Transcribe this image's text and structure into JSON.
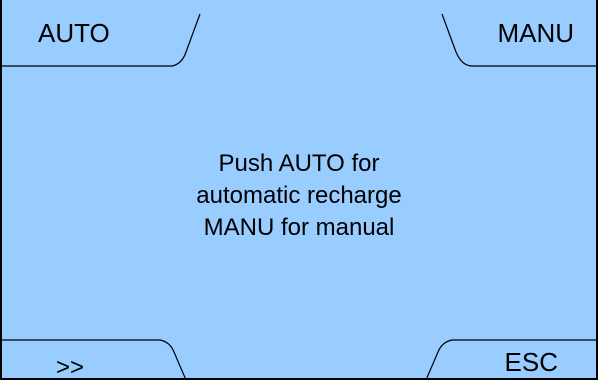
{
  "softkeys": {
    "top_left": "AUTO",
    "top_right": "MANU",
    "bottom_left": ">>",
    "bottom_right": "ESC"
  },
  "message": {
    "line1": "Push AUTO for",
    "line2": "automatic recharge",
    "line3": "MANU for manual"
  },
  "colors": {
    "background": "#99ccff",
    "foreground": "#000000"
  }
}
